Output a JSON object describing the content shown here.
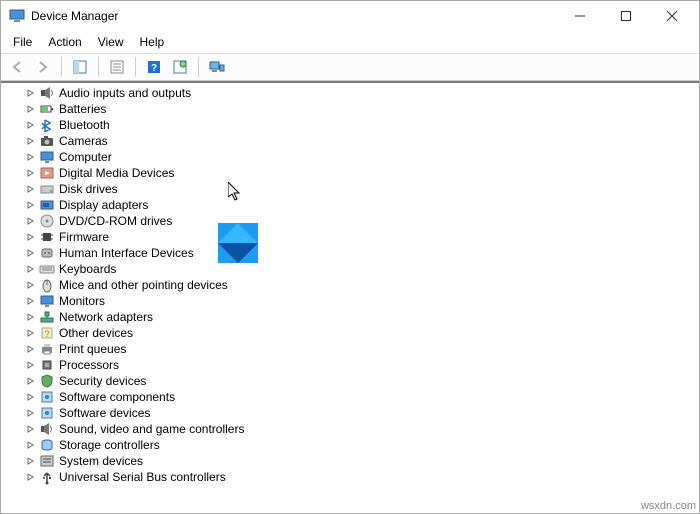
{
  "window": {
    "title": "Device Manager"
  },
  "menubar": [
    "File",
    "Action",
    "View",
    "Help"
  ],
  "toolbar": [
    {
      "name": "back",
      "disabled": true
    },
    {
      "name": "forward",
      "disabled": true
    },
    {
      "sep": true
    },
    {
      "name": "show-hide-console-tree"
    },
    {
      "sep": true
    },
    {
      "name": "properties"
    },
    {
      "sep": true
    },
    {
      "name": "help"
    },
    {
      "name": "action-center"
    },
    {
      "sep": true
    },
    {
      "name": "display"
    }
  ],
  "tree": [
    {
      "label": "Audio inputs and outputs",
      "icon": "speaker"
    },
    {
      "label": "Batteries",
      "icon": "battery"
    },
    {
      "label": "Bluetooth",
      "icon": "bluetooth"
    },
    {
      "label": "Cameras",
      "icon": "camera"
    },
    {
      "label": "Computer",
      "icon": "monitor"
    },
    {
      "label": "Digital Media Devices",
      "icon": "media"
    },
    {
      "label": "Disk drives",
      "icon": "drive"
    },
    {
      "label": "Display adapters",
      "icon": "display-adapter"
    },
    {
      "label": "DVD/CD-ROM drives",
      "icon": "disc"
    },
    {
      "label": "Firmware",
      "icon": "chip"
    },
    {
      "label": "Human Interface Devices",
      "icon": "hid"
    },
    {
      "label": "Keyboards",
      "icon": "keyboard"
    },
    {
      "label": "Mice and other pointing devices",
      "icon": "mouse"
    },
    {
      "label": "Monitors",
      "icon": "monitor"
    },
    {
      "label": "Network adapters",
      "icon": "network"
    },
    {
      "label": "Other devices",
      "icon": "other"
    },
    {
      "label": "Print queues",
      "icon": "printer"
    },
    {
      "label": "Processors",
      "icon": "cpu"
    },
    {
      "label": "Security devices",
      "icon": "security"
    },
    {
      "label": "Software components",
      "icon": "software"
    },
    {
      "label": "Software devices",
      "icon": "software"
    },
    {
      "label": "Sound, video and game controllers",
      "icon": "sound"
    },
    {
      "label": "Storage controllers",
      "icon": "storage"
    },
    {
      "label": "System devices",
      "icon": "system"
    },
    {
      "label": "Universal Serial Bus controllers",
      "icon": "usb"
    }
  ],
  "watermark": "wsxdn.com"
}
